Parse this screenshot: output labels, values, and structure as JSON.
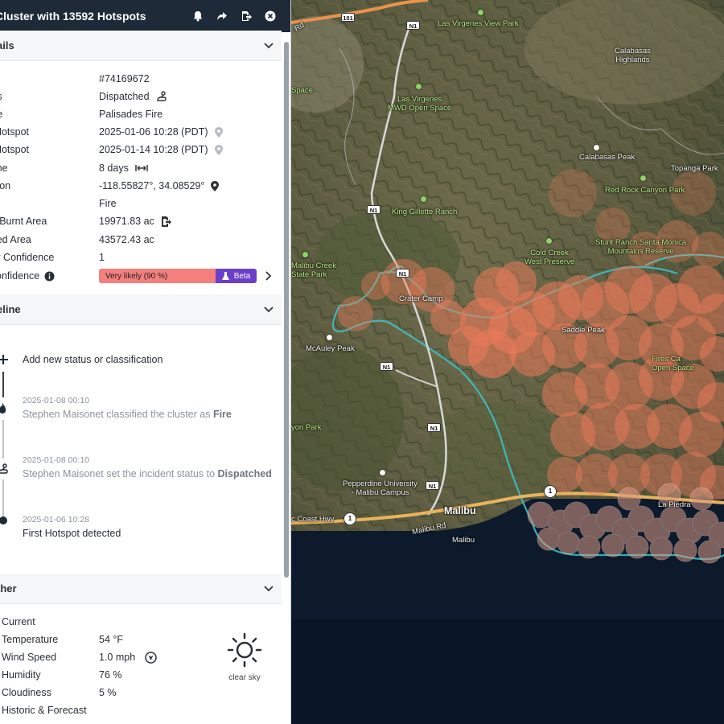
{
  "panel": {
    "title": "Cluster with 13592 Hotspots",
    "details": {
      "header": "ails",
      "rows": [
        {
          "key": "",
          "value": "#74169672"
        },
        {
          "key": "tus",
          "value": "Dispatched"
        },
        {
          "key": "me",
          "value": "Palisades Fire"
        },
        {
          "key": "t Hotspot",
          "value": "2025-01-06 10:28 (PDT)"
        },
        {
          "key": "t Hotspot",
          "value": "2025-01-14 10:28 (PDT)"
        },
        {
          "key": "time",
          "value": "8 days"
        },
        {
          "key": "ation",
          "value": "-118.55827°, 34.08529°"
        },
        {
          "key": "e",
          "value": "Fire"
        },
        {
          "key": "al Burnt Area",
          "value": "19971.83 ac"
        },
        {
          "key": "cted Area",
          "value": "43572.43 ac"
        },
        {
          "key": "ter Confidence",
          "value": "1"
        },
        {
          "key": " Confidence",
          "value": ""
        }
      ],
      "confidence_label": "Very likely (90 %)",
      "confidence_level": 0.9,
      "beta_label": "Beta"
    },
    "timeline": {
      "header": "eline",
      "add_label": "Add new status or classification",
      "items": [
        {
          "date": "2025-01-08 00:10",
          "text": "Stephen Maisonet classified the cluster as ",
          "bold": "Fire"
        },
        {
          "date": "2025-01-08 00:10",
          "text": "Stephen Maisonet set the incident status to ",
          "bold": "Dispatched"
        },
        {
          "date": "2025-01-06 10:28",
          "text": "First Hotspot detected",
          "bold": ""
        }
      ]
    },
    "weather": {
      "header": "ther",
      "current_label": "Current",
      "rows": [
        {
          "key": "Temperature",
          "value": "54 °F"
        },
        {
          "key": "Wind Speed",
          "value": "1.0 mph"
        },
        {
          "key": "Humidity",
          "value": "76 %"
        },
        {
          "key": "Cloudiness",
          "value": "5 %"
        }
      ],
      "condition": "clear sky",
      "historic_label": "Historic & Forecast"
    }
  },
  "map": {
    "labels": [
      {
        "text": "Las Virgenes View Park",
        "kind": "green"
      },
      {
        "text": "Calabasas\nHighlands",
        "kind": "white"
      },
      {
        "text": "Space",
        "kind": "green"
      },
      {
        "text": "Las Virgenes\nMWD Open Space",
        "kind": "green"
      },
      {
        "text": "Calabasas Peak",
        "kind": "white"
      },
      {
        "text": "Topanga Park",
        "kind": "white"
      },
      {
        "text": "Red Rock Canyon Park",
        "kind": "green"
      },
      {
        "text": "King Gillette Ranch",
        "kind": "green"
      },
      {
        "text": "Cold Creek\nWest Preserve",
        "kind": "green"
      },
      {
        "text": "Stunt Ranch Santa Monica\nMountains Reserve",
        "kind": "green"
      },
      {
        "text": "Malibu Creek\nState Park",
        "kind": "green"
      },
      {
        "text": "Crater Camp",
        "kind": "white"
      },
      {
        "text": "Saddle Peak",
        "kind": "white"
      },
      {
        "text": "McAuley Peak",
        "kind": "white"
      },
      {
        "text": "Fires Ca\nOpen Space",
        "kind": "green"
      },
      {
        "text": "yon Park",
        "kind": "green"
      },
      {
        "text": "Pepperdine University\n- Malibu Campus",
        "kind": "white"
      },
      {
        "text": "Malibu",
        "kind": "town"
      },
      {
        "text": "Malibu",
        "kind": "white"
      },
      {
        "text": "Malibu Rd",
        "kind": "white"
      },
      {
        "text": "c Coast Hwy",
        "kind": "white"
      },
      {
        "text": "Rd",
        "kind": "white"
      },
      {
        "text": "La Piedra",
        "kind": "white"
      }
    ],
    "shields": [
      "101",
      "N1",
      "N1",
      "N1",
      "N1",
      "N1",
      "N1",
      "1",
      "1"
    ],
    "colors": {
      "hotspot": "#ec7a5a",
      "boundary": "#3cc6c9",
      "road_primary": "#e9b35c",
      "water": "#0c1a2c"
    }
  }
}
